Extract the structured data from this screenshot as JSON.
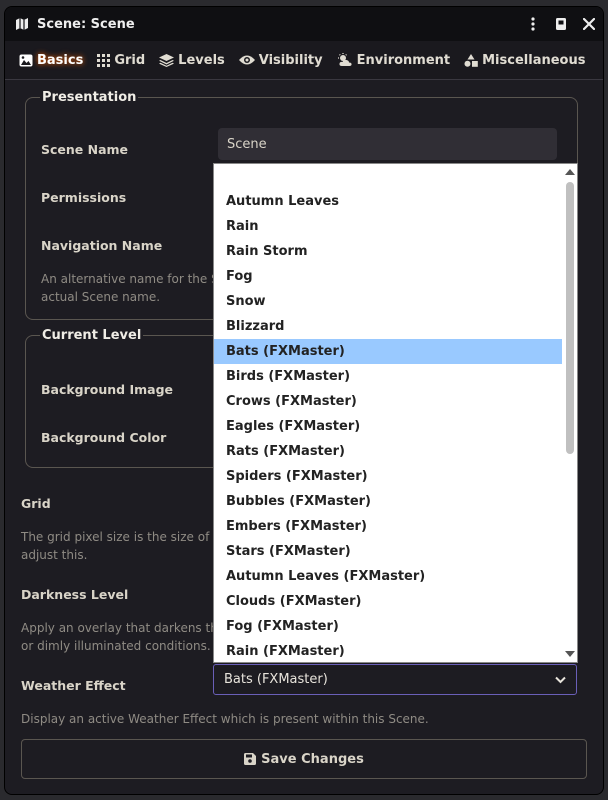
{
  "window": {
    "title": "Scene: Scene"
  },
  "tabs": [
    {
      "label": "Basics",
      "icon": "image-icon"
    },
    {
      "label": "Grid",
      "icon": "grid-icon"
    },
    {
      "label": "Levels",
      "icon": "layers-icon"
    },
    {
      "label": "Visibility",
      "icon": "eye-icon"
    },
    {
      "label": "Environment",
      "icon": "cloud-sun-icon"
    },
    {
      "label": "Miscellaneous",
      "icon": "shapes-icon"
    }
  ],
  "presentation": {
    "legend": "Presentation",
    "scene_name_label": "Scene Name",
    "scene_name_value": "Scene",
    "permissions_label": "Permissions",
    "navigation_name_label": "Navigation Name",
    "navigation_hint_line1": "An alternative name for the S",
    "navigation_hint_line2": "actual Scene name."
  },
  "current_level": {
    "legend": "Current Level",
    "background_image_label": "Background Image",
    "background_color_label": "Background Color"
  },
  "grid": {
    "label": "Grid",
    "hint_line1": "The grid pixel size is the size of a",
    "hint_line2": "adjust this."
  },
  "darkness": {
    "label": "Darkness Level",
    "hint_line1": "Apply an overlay that darkens th",
    "hint_line2": "or dimly illuminated conditions."
  },
  "weather": {
    "label": "Weather Effect",
    "selected": "Bats (FXMaster)",
    "hint": "Display an active Weather Effect which is present within this Scene.",
    "options": [
      "",
      "Autumn Leaves",
      "Rain",
      "Rain Storm",
      "Fog",
      "Snow",
      "Blizzard",
      "Bats (FXMaster)",
      "Birds (FXMaster)",
      "Crows (FXMaster)",
      "Eagles (FXMaster)",
      "Rats (FXMaster)",
      "Spiders (FXMaster)",
      "Bubbles (FXMaster)",
      "Embers (FXMaster)",
      "Stars (FXMaster)",
      "Autumn Leaves (FXMaster)",
      "Clouds (FXMaster)",
      "Fog (FXMaster)",
      "Rain (FXMaster)"
    ],
    "selected_index": 7
  },
  "save_label": "Save Changes",
  "colors": {
    "accent_glow": "#ff6400",
    "selected_option": "#99c9ff",
    "select_border": "#6a5fb8"
  }
}
